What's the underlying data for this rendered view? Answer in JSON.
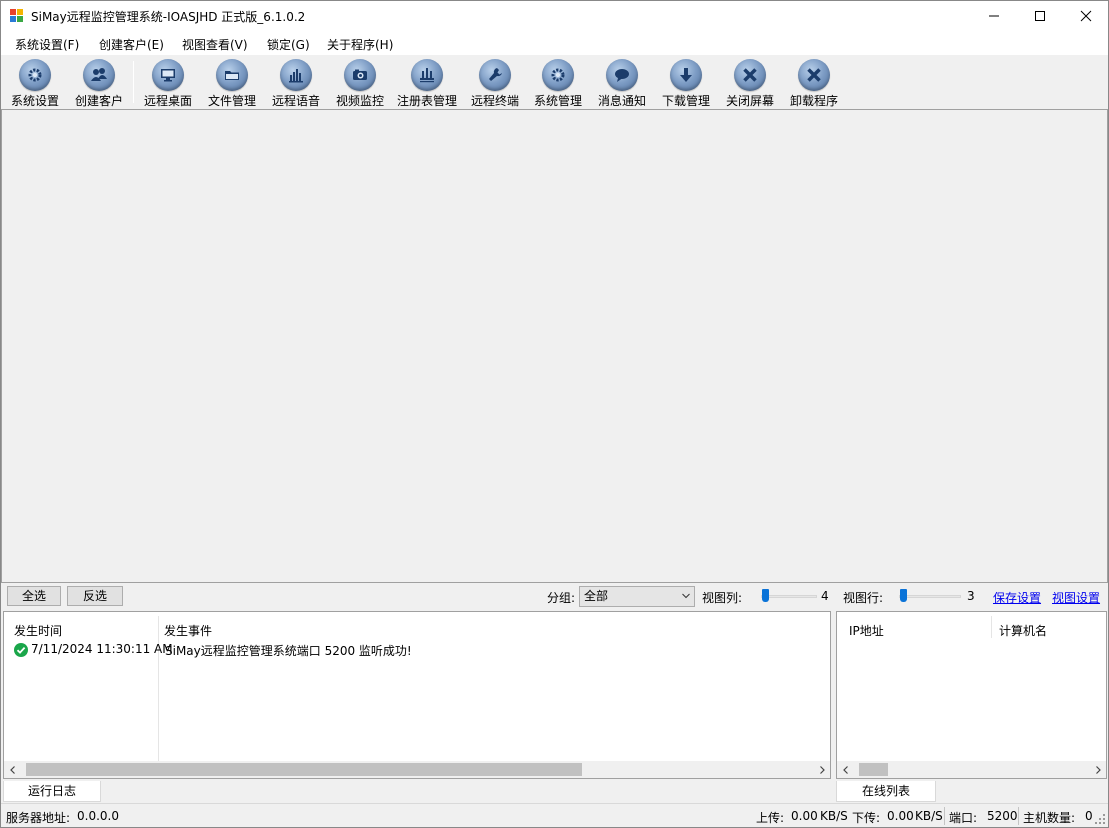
{
  "window": {
    "title": "SiMay远程监控管理系统-IOASJHD 正式版_6.1.0.2"
  },
  "menu": {
    "items": [
      "系统设置(F)",
      "创建客户(E)",
      "视图查看(V)",
      "锁定(G)",
      "关于程序(H)"
    ]
  },
  "toolbar": {
    "items": [
      {
        "label": "系统设置",
        "icon": "gear-icon"
      },
      {
        "label": "创建客户",
        "icon": "users-icon"
      },
      {
        "label": "远程桌面",
        "icon": "monitor-icon"
      },
      {
        "label": "文件管理",
        "icon": "folder-icon"
      },
      {
        "label": "远程语音",
        "icon": "audio-bars-icon"
      },
      {
        "label": "视频监控",
        "icon": "camera-icon"
      },
      {
        "label": "注册表管理",
        "icon": "registry-icon"
      },
      {
        "label": "远程终端",
        "icon": "wrench-icon"
      },
      {
        "label": "系统管理",
        "icon": "gear-icon"
      },
      {
        "label": "消息通知",
        "icon": "speech-bubble-icon"
      },
      {
        "label": "下载管理",
        "icon": "download-arrow-icon"
      },
      {
        "label": "关闭屏幕",
        "icon": "close-x-icon"
      },
      {
        "label": "卸载程序",
        "icon": "close-x-icon"
      }
    ]
  },
  "controls": {
    "select_all": "全选",
    "invert": "反选",
    "group_label": "分组:",
    "group_value": "全部",
    "view_cols_label": "视图列:",
    "view_cols_value": 4,
    "view_rows_label": "视图行:",
    "view_rows_value": 3,
    "save_settings": "保存设置",
    "view_settings": "视图设置"
  },
  "log": {
    "headers": [
      "发生时间",
      "发生事件"
    ],
    "rows": [
      {
        "time": "7/11/2024 11:30:11 AM",
        "event": "SiMay远程监控管理系统端口 5200 监听成功!",
        "status_color": "#1aa64a"
      }
    ]
  },
  "online": {
    "headers": [
      "IP地址",
      "计算机名"
    ]
  },
  "tabs": {
    "log": "运行日志",
    "online": "在线列表"
  },
  "status": {
    "server_label": "服务器地址:",
    "server_value": "0.0.0.0",
    "upload": "上传:",
    "upload_value": "0.00",
    "upload_unit": "KB/S",
    "download": "下传:",
    "download_value": "0.00",
    "download_unit": "KB/S",
    "port_label": "端口:",
    "port_value": "5200",
    "host_count_label": "主机数量:",
    "host_count_value": "0"
  },
  "colors": {
    "link": "#0000ee",
    "slider_thumb": "#0a73d8",
    "icon_blue": "#6d8fbd"
  }
}
